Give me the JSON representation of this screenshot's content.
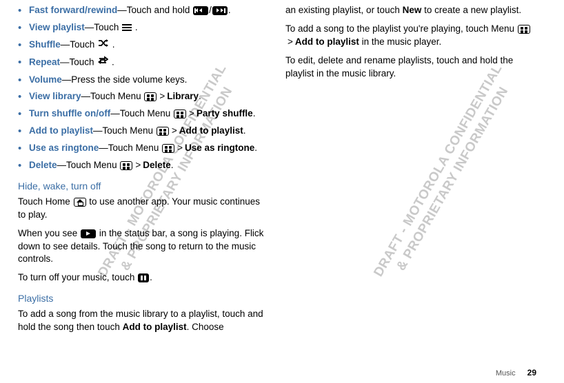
{
  "watermark_line1": "DRAFT - MOTOROLA CONFIDENTIAL",
  "watermark_line2": "& PROPRIETARY INFORMATION",
  "col1": {
    "bullets": {
      "ffwd_kw": "Fast forward/rewind",
      "ffwd_txt": "—Touch and hold ",
      "ffwd_slash": "/",
      "ffwd_end": ".",
      "viewpl_kw": "View playlist",
      "viewpl_txt": "—Touch ",
      "viewpl_end": " .",
      "shuffle_kw": "Shuffle",
      "shuffle_txt": "—Touch ",
      "shuffle_end": " .",
      "repeat_kw": "Repeat",
      "repeat_txt": "—Touch ",
      "repeat_end": " .",
      "volume_kw": "Volume",
      "volume_txt": "—Press the side volume keys.",
      "viewlib_kw": "View library",
      "viewlib_txt": "—Touch Menu ",
      "viewlib_bold": "Library",
      "viewlib_end": ".",
      "turnsh_kw": "Turn shuffle on/off",
      "turnsh_txt": "—Touch Menu  ",
      "turnsh_bold": "Party shuffle",
      "turnsh_end": ".",
      "addpl_kw": "Add to playlist",
      "addpl_txt": "—Touch Menu ",
      "addpl_bold": "Add to playlist",
      "addpl_end": ".",
      "ring_kw": "Use as ringtone",
      "ring_txt": "—Touch Menu ",
      "ring_bold": "Use as ringtone",
      "ring_end": ".",
      "del_kw": "Delete",
      "del_txt": "—Touch Menu ",
      "del_bold": "Delete",
      "del_end": "."
    },
    "sec1_head": "Hide, wake, turn off",
    "sec1_p1a": "Touch Home ",
    "sec1_p1b": " to use another app. Your music continues to play.",
    "sec1_p2a": "When you see ",
    "sec1_p2b": " in the status bar, a song is playing. Flick down to see details. Touch the song to return to the music controls.",
    "sec1_p3a": "To turn off your music, touch ",
    "sec1_p3b": ".",
    "sec2_head": "Playlists",
    "sec2_p1a": "To add a song from the music library to a playlist, touch and hold the song then touch ",
    "sec2_p1bold": "Add to playlist",
    "sec2_p1b": ". Choose"
  },
  "col2": {
    "p1a": "an existing playlist, or touch ",
    "p1bold": "New",
    "p1b": " to create a new playlist.",
    "p2a": "To add a song to the playlist you're playing, touch Menu ",
    "p2bold": "Add to playlist",
    "p2b": " in the music player.",
    "p3": "To edit, delete and rename playlists, touch and hold the playlist in the music library."
  },
  "gt": ">",
  "footer_label": "Music",
  "footer_page": "29"
}
